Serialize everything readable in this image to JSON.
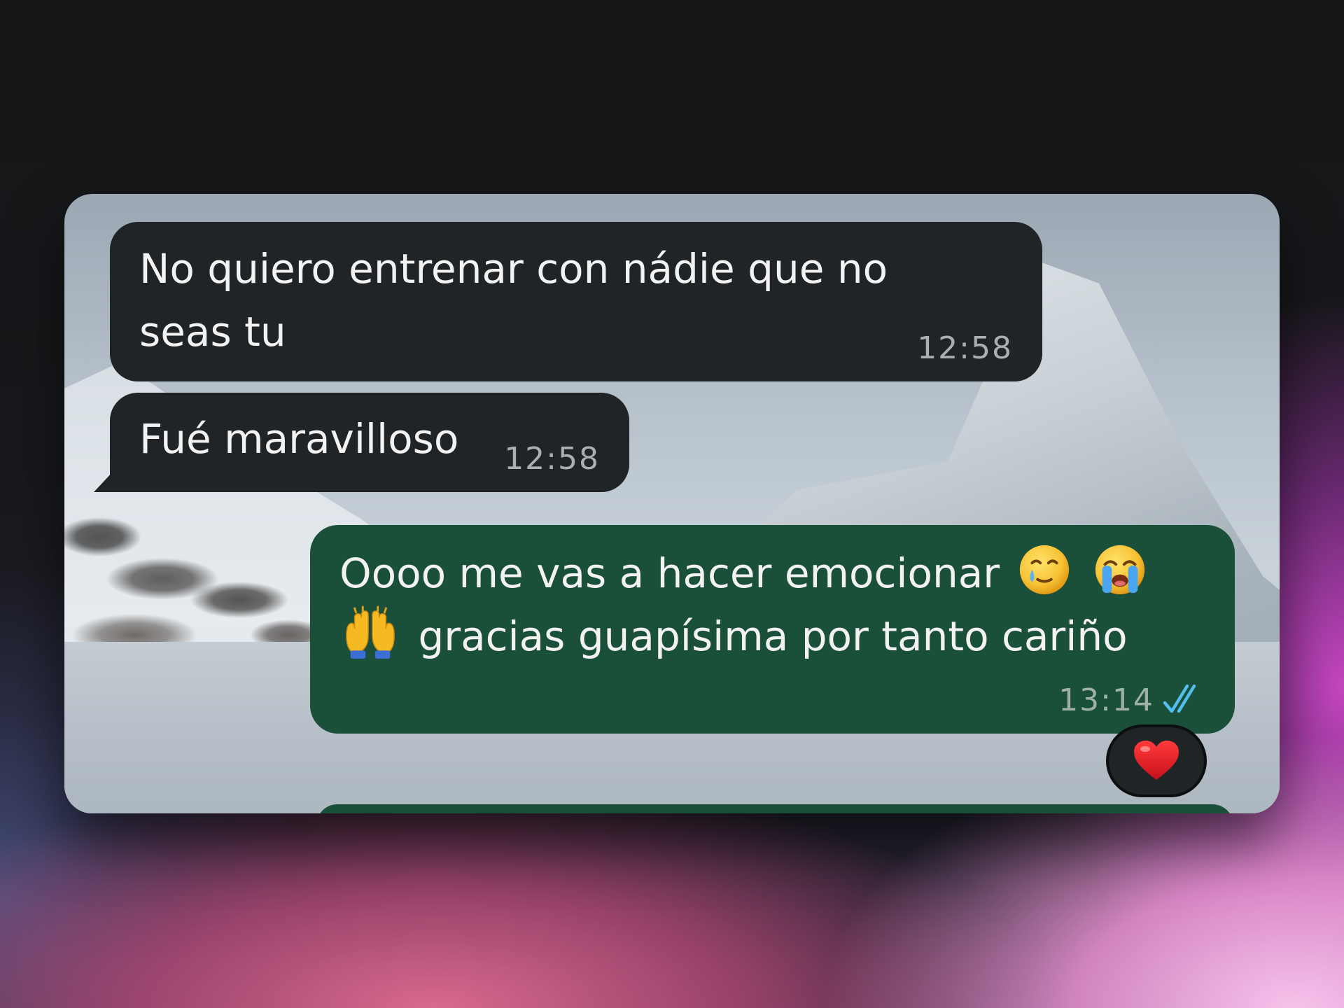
{
  "chat": {
    "messages": [
      {
        "direction": "incoming",
        "lines": [
          "No quiero entrenar con nádie que no",
          "seas tu"
        ],
        "time": "12:58"
      },
      {
        "direction": "incoming",
        "text": "Fué maravilloso",
        "time": "12:58"
      },
      {
        "direction": "outgoing",
        "line1_text": "Oooo me vas a hacer emocionar",
        "line1_emojis": [
          "face-holding-back-tears-icon",
          "loudly-crying-face-icon"
        ],
        "line2_emoji": "raising-hands-icon",
        "line2_text": "gracias guapísima por tanto cariño",
        "time": "13:14",
        "status_icon": "double-check-read-icon",
        "reaction": "red-heart-icon"
      }
    ]
  },
  "colors": {
    "incoming_bubble": "#202426",
    "outgoing_bubble": "#1a4f3a",
    "read_check": "#53bdeb",
    "timestamp": "#a9b0b3"
  }
}
